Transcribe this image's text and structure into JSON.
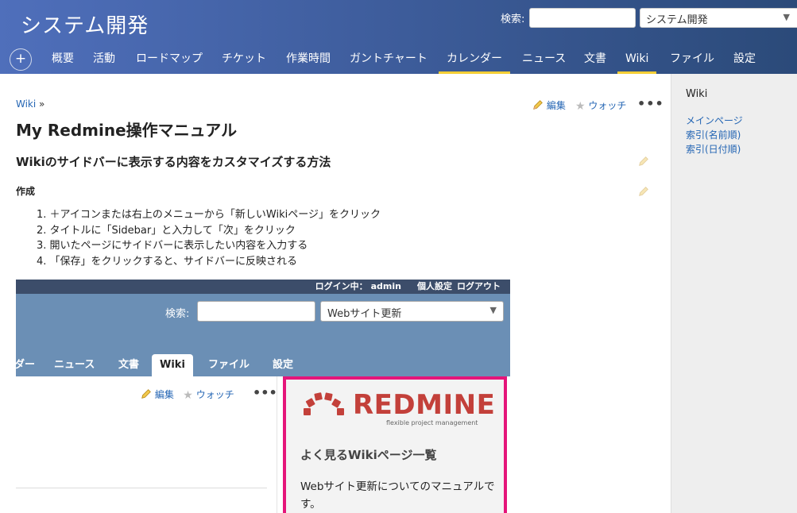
{
  "header": {
    "project_title": "システム開発",
    "search_label": "検索:",
    "search_value": "",
    "project_select": "システム開発"
  },
  "nav": {
    "new_button": "+",
    "tabs": [
      {
        "label": "概要"
      },
      {
        "label": "活動"
      },
      {
        "label": "ロードマップ"
      },
      {
        "label": "チケット"
      },
      {
        "label": "作業時間"
      },
      {
        "label": "ガントチャート"
      },
      {
        "label": "カレンダー",
        "selected": true
      },
      {
        "label": "ニュース"
      },
      {
        "label": "文書"
      },
      {
        "label": "Wiki",
        "selected": true
      },
      {
        "label": "ファイル"
      },
      {
        "label": "設定"
      }
    ]
  },
  "content": {
    "breadcrumb": "Wiki",
    "breadcrumb_sep": "»",
    "edit_label": "編集",
    "watch_label": "ウォッチ",
    "more": "•••",
    "page_title": "My Redmine操作マニュアル",
    "section_title": "Wikiのサイドバーに表示する内容をカスタマイズする方法",
    "subsection_title": "作成",
    "steps": [
      "1. ＋アイコンまたは右上のメニューから「新しいWikiページ」をクリック",
      "2. タイトルに「Sidebar」と入力して「次」をクリック",
      "3. 開いたページにサイドバーに表示したい内容を入力する",
      "4. 「保存」をクリックすると、サイドバーに反映される"
    ]
  },
  "screenshot": {
    "logged_in_label": "ログイン中：",
    "user": "admin",
    "my_account": "個人設定",
    "logout": "ログアウト",
    "search_label": "検索:",
    "project_select": "Webサイト更新",
    "tabs": [
      "ダー",
      "ニュース",
      "文書",
      "Wiki",
      "ファイル",
      "設定"
    ],
    "edit_label": "編集",
    "watch_label": "ウォッチ",
    "more": "•••",
    "logo_text": "REDMINE",
    "logo_sub": "flexible project management",
    "sidebar_title": "よく見るWikiページ一覧",
    "sidebar_text": "Webサイト更新についてのマニュアルです。",
    "highlight_color": "#e5157a"
  },
  "sidebar": {
    "title": "Wiki",
    "links": [
      "メインページ",
      "索引(名前順)",
      "索引(日付順)"
    ]
  }
}
